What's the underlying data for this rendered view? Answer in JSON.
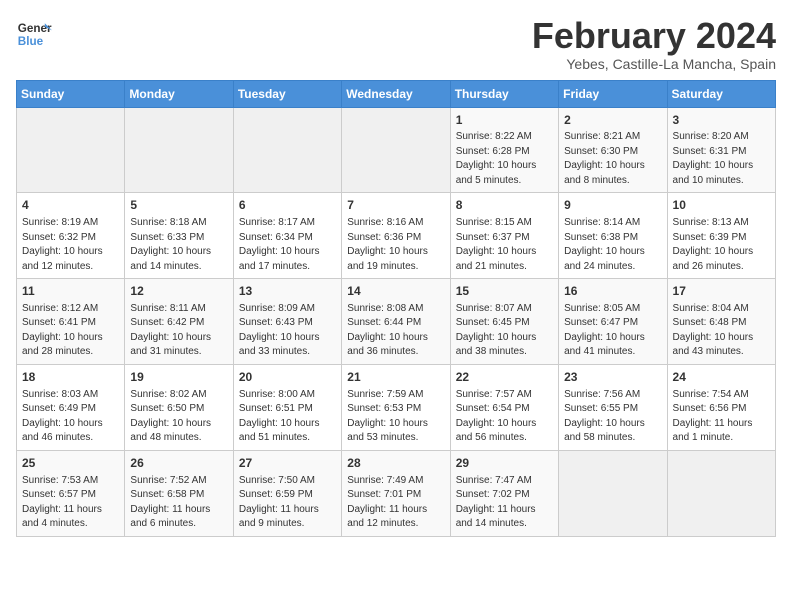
{
  "app": {
    "logo_line1": "General",
    "logo_line2": "Blue"
  },
  "header": {
    "month": "February 2024",
    "location": "Yebes, Castille-La Mancha, Spain"
  },
  "weekdays": [
    "Sunday",
    "Monday",
    "Tuesday",
    "Wednesday",
    "Thursday",
    "Friday",
    "Saturday"
  ],
  "weeks": [
    [
      {
        "day": "",
        "info": ""
      },
      {
        "day": "",
        "info": ""
      },
      {
        "day": "",
        "info": ""
      },
      {
        "day": "",
        "info": ""
      },
      {
        "day": "1",
        "info": "Sunrise: 8:22 AM\nSunset: 6:28 PM\nDaylight: 10 hours\nand 5 minutes."
      },
      {
        "day": "2",
        "info": "Sunrise: 8:21 AM\nSunset: 6:30 PM\nDaylight: 10 hours\nand 8 minutes."
      },
      {
        "day": "3",
        "info": "Sunrise: 8:20 AM\nSunset: 6:31 PM\nDaylight: 10 hours\nand 10 minutes."
      }
    ],
    [
      {
        "day": "4",
        "info": "Sunrise: 8:19 AM\nSunset: 6:32 PM\nDaylight: 10 hours\nand 12 minutes."
      },
      {
        "day": "5",
        "info": "Sunrise: 8:18 AM\nSunset: 6:33 PM\nDaylight: 10 hours\nand 14 minutes."
      },
      {
        "day": "6",
        "info": "Sunrise: 8:17 AM\nSunset: 6:34 PM\nDaylight: 10 hours\nand 17 minutes."
      },
      {
        "day": "7",
        "info": "Sunrise: 8:16 AM\nSunset: 6:36 PM\nDaylight: 10 hours\nand 19 minutes."
      },
      {
        "day": "8",
        "info": "Sunrise: 8:15 AM\nSunset: 6:37 PM\nDaylight: 10 hours\nand 21 minutes."
      },
      {
        "day": "9",
        "info": "Sunrise: 8:14 AM\nSunset: 6:38 PM\nDaylight: 10 hours\nand 24 minutes."
      },
      {
        "day": "10",
        "info": "Sunrise: 8:13 AM\nSunset: 6:39 PM\nDaylight: 10 hours\nand 26 minutes."
      }
    ],
    [
      {
        "day": "11",
        "info": "Sunrise: 8:12 AM\nSunset: 6:41 PM\nDaylight: 10 hours\nand 28 minutes."
      },
      {
        "day": "12",
        "info": "Sunrise: 8:11 AM\nSunset: 6:42 PM\nDaylight: 10 hours\nand 31 minutes."
      },
      {
        "day": "13",
        "info": "Sunrise: 8:09 AM\nSunset: 6:43 PM\nDaylight: 10 hours\nand 33 minutes."
      },
      {
        "day": "14",
        "info": "Sunrise: 8:08 AM\nSunset: 6:44 PM\nDaylight: 10 hours\nand 36 minutes."
      },
      {
        "day": "15",
        "info": "Sunrise: 8:07 AM\nSunset: 6:45 PM\nDaylight: 10 hours\nand 38 minutes."
      },
      {
        "day": "16",
        "info": "Sunrise: 8:05 AM\nSunset: 6:47 PM\nDaylight: 10 hours\nand 41 minutes."
      },
      {
        "day": "17",
        "info": "Sunrise: 8:04 AM\nSunset: 6:48 PM\nDaylight: 10 hours\nand 43 minutes."
      }
    ],
    [
      {
        "day": "18",
        "info": "Sunrise: 8:03 AM\nSunset: 6:49 PM\nDaylight: 10 hours\nand 46 minutes."
      },
      {
        "day": "19",
        "info": "Sunrise: 8:02 AM\nSunset: 6:50 PM\nDaylight: 10 hours\nand 48 minutes."
      },
      {
        "day": "20",
        "info": "Sunrise: 8:00 AM\nSunset: 6:51 PM\nDaylight: 10 hours\nand 51 minutes."
      },
      {
        "day": "21",
        "info": "Sunrise: 7:59 AM\nSunset: 6:53 PM\nDaylight: 10 hours\nand 53 minutes."
      },
      {
        "day": "22",
        "info": "Sunrise: 7:57 AM\nSunset: 6:54 PM\nDaylight: 10 hours\nand 56 minutes."
      },
      {
        "day": "23",
        "info": "Sunrise: 7:56 AM\nSunset: 6:55 PM\nDaylight: 10 hours\nand 58 minutes."
      },
      {
        "day": "24",
        "info": "Sunrise: 7:54 AM\nSunset: 6:56 PM\nDaylight: 11 hours\nand 1 minute."
      }
    ],
    [
      {
        "day": "25",
        "info": "Sunrise: 7:53 AM\nSunset: 6:57 PM\nDaylight: 11 hours\nand 4 minutes."
      },
      {
        "day": "26",
        "info": "Sunrise: 7:52 AM\nSunset: 6:58 PM\nDaylight: 11 hours\nand 6 minutes."
      },
      {
        "day": "27",
        "info": "Sunrise: 7:50 AM\nSunset: 6:59 PM\nDaylight: 11 hours\nand 9 minutes."
      },
      {
        "day": "28",
        "info": "Sunrise: 7:49 AM\nSunset: 7:01 PM\nDaylight: 11 hours\nand 12 minutes."
      },
      {
        "day": "29",
        "info": "Sunrise: 7:47 AM\nSunset: 7:02 PM\nDaylight: 11 hours\nand 14 minutes."
      },
      {
        "day": "",
        "info": ""
      },
      {
        "day": "",
        "info": ""
      }
    ]
  ]
}
